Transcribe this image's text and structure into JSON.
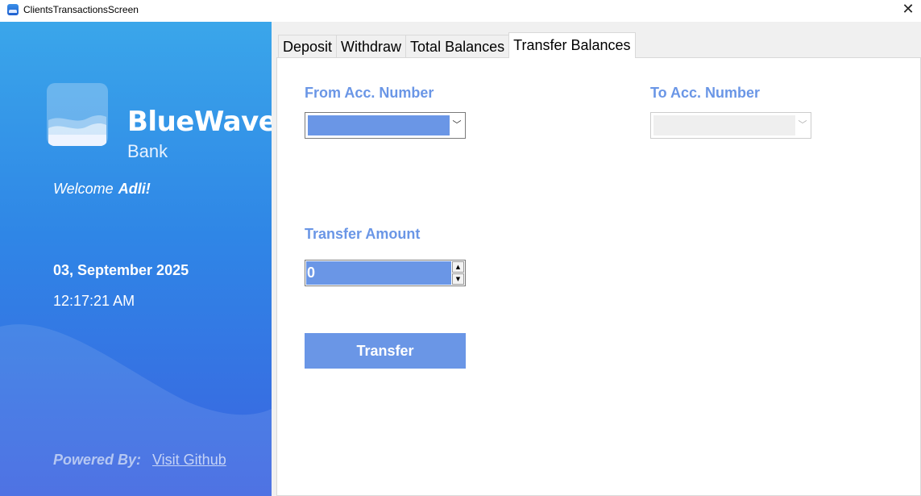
{
  "window": {
    "title": "ClientsTransactionsScreen",
    "close_icon": "close-icon",
    "close_glyph": "✕"
  },
  "sidebar": {
    "brand_name": "BlueWave",
    "brand_sub": "Bank",
    "welcome_text": "Welcome",
    "user_name": "Adli!",
    "date": "03, September 2025",
    "time": "12:17:21 AM",
    "powered_by": "Powered By:",
    "github_link": "Visit Github",
    "colors": {
      "top": "#3aa6ea",
      "bottom": "#3b63e0"
    }
  },
  "tabs": [
    {
      "label": "Deposit",
      "active": false
    },
    {
      "label": "Withdraw",
      "active": false
    },
    {
      "label": "Total Balances",
      "active": false
    },
    {
      "label": "Transfer Balances",
      "active": true
    }
  ],
  "transfer_form": {
    "from_label": "From Acc. Number",
    "from_value": "",
    "to_label": "To Acc. Number",
    "to_value": "",
    "to_enabled": false,
    "amount_label": "Transfer Amount",
    "amount_value": "0",
    "submit_label": "Transfer",
    "dropdown_arrow": "﹀",
    "spin_up": "▲",
    "spin_down": "▼",
    "accent_color": "#6a96e6"
  }
}
